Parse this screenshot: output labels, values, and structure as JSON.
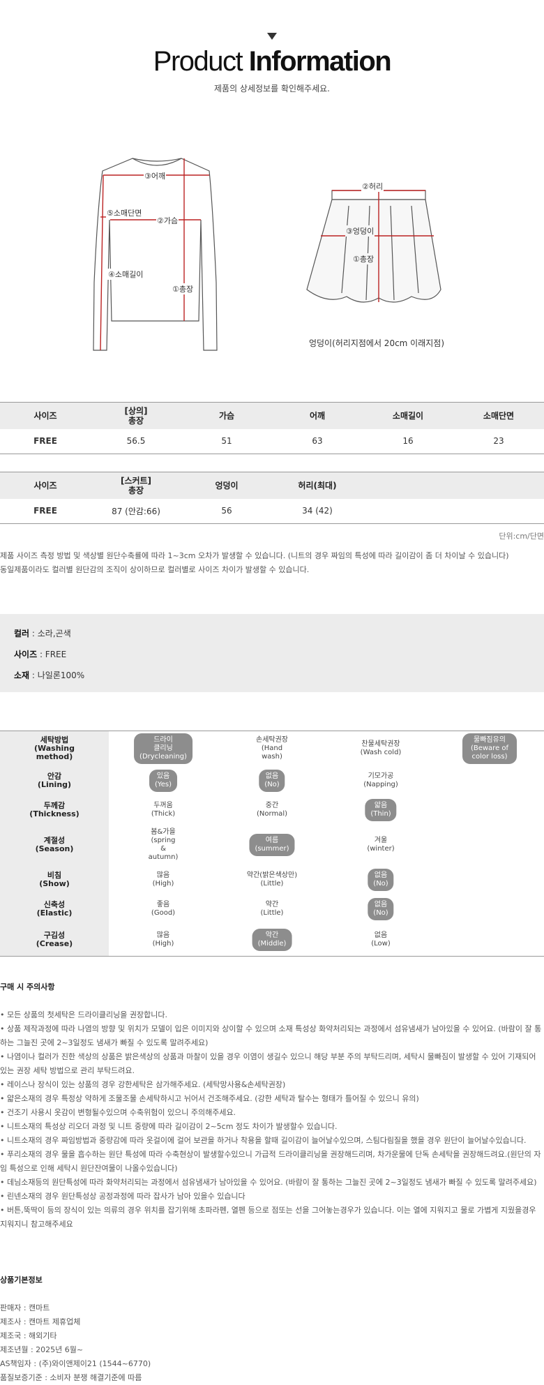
{
  "header": {
    "title_light": "Product",
    "title_bold": "Information",
    "subtitle": "제품의 상세정보를 확인해주세요."
  },
  "figures": {
    "top_labels": [
      "③어깨",
      "⑤소매단면",
      "②가슴",
      "④소매길이",
      "①총장"
    ],
    "skirt_labels": [
      "②허리",
      "③엉덩이",
      "①총장"
    ],
    "skirt_caption": "엉덩이(허리지점에서 20cm 이래지점)"
  },
  "table_top": {
    "headers": [
      "사이즈",
      "[상의]\n총장",
      "가슴",
      "어깨",
      "소매길이",
      "소매단면"
    ],
    "rows": [
      [
        "FREE",
        "56.5",
        "51",
        "63",
        "16",
        "23"
      ]
    ]
  },
  "table_skirt": {
    "headers": [
      "사이즈",
      "[스커트]\n총장",
      "엉덩이",
      "허리(최대)"
    ],
    "rows": [
      [
        "FREE",
        "87 (안감:66)",
        "56",
        "34 (42)"
      ]
    ]
  },
  "unit_text": "단위:cm/단면",
  "notes": [
    "제품 사이즈 측정 방법 및 색상별 원단수축률에 따라 1~3cm 오차가 발생할 수 있습니다. (니트의 경우 짜임의 특성에 따라 길이감이 좀 더 차이날 수 있습니다)",
    "동일제품이라도 컬러별 원단감의 조직이 상이하므로 컬러별로 사이즈 차이가 발생할 수 있습니다."
  ],
  "spec": {
    "color_label": "컬러",
    "color_value": " : 소라,곤색",
    "size_label": "사이즈",
    "size_value": " : FREE",
    "material_label": "소재",
    "material_value": " : 나일론100%"
  },
  "care": [
    {
      "label": "세탁방법\n(Washing\nmethod)",
      "options": [
        {
          "text": "드라이\n클리닝\n(Drycleaning)",
          "selected": true
        },
        {
          "text": "손세탁권장\n(Hand\nwash)",
          "selected": false
        },
        {
          "text": "찬물세탁권장\n(Wash cold)",
          "selected": false
        },
        {
          "text": "물빠짐유의\n(Beware of color loss)",
          "selected": true
        }
      ]
    },
    {
      "label": "안감\n(Lining)",
      "options": [
        {
          "text": "있음\n(Yes)",
          "selected": true
        },
        {
          "text": "없음\n(No)",
          "selected": true
        },
        {
          "text": "기모가공\n(Napping)",
          "selected": false
        }
      ]
    },
    {
      "label": "두께감\n(Thickness)",
      "options": [
        {
          "text": "두꺼움\n(Thick)",
          "selected": false
        },
        {
          "text": "중간\n(Normal)",
          "selected": false
        },
        {
          "text": "얇음\n(Thin)",
          "selected": true
        }
      ]
    },
    {
      "label": "계절성\n(Season)",
      "options": [
        {
          "text": "봄&가을\n(spring\n&\nautumn)",
          "selected": false
        },
        {
          "text": "여름\n(summer)",
          "selected": true
        },
        {
          "text": "겨울\n(winter)",
          "selected": false
        }
      ]
    },
    {
      "label": "비침\n(Show)",
      "options": [
        {
          "text": "많음\n(High)",
          "selected": false
        },
        {
          "text": "약간(밝은색상만)\n(Little)",
          "selected": false
        },
        {
          "text": "없음\n(No)",
          "selected": true
        }
      ]
    },
    {
      "label": "신축성\n(Elastic)",
      "options": [
        {
          "text": "좋음\n(Good)",
          "selected": false
        },
        {
          "text": "약간\n(Little)",
          "selected": false
        },
        {
          "text": "없음\n(No)",
          "selected": true
        }
      ]
    },
    {
      "label": "구김성\n(Crease)",
      "options": [
        {
          "text": "많음\n(High)",
          "selected": false
        },
        {
          "text": "약간\n(Middle)",
          "selected": true
        },
        {
          "text": "없음\n(Low)",
          "selected": false
        }
      ]
    }
  ],
  "caution": {
    "heading": "구매 시 주의사항",
    "items": [
      "• 모든 상품의 첫세탁은 드라이클리닝을 권장합니다.",
      "• 상품 제작과정에 따라 나염의 방향 및 위치가 모델이 입은 이미지와 상이할 수 있으며 소재 특성상 화약처리되는 과정에서 섬유냄새가 남아있을 수 있어요. (바람이 잘 통",
      "하는 그늘진 곳에 2~3일정도 냄새가 빠질 수 있도록 말려주세요)",
      "• 나염이나 컬러가 진한 색상의 상품은 밝은색상의 상품과 마찰이 있을 경우 이염이 생길수 있으니 해당 부분 주의 부탁드리며, 세탁시 물빠짐이 발생할 수 있어 기재되어",
      "있는 권장 세탁 방법으로 관리 부탁드려요.",
      "• 레이스나 장식이 있는 상품의 경우 강한세탁은 삼가해주세요. (세탁망사용&손세탁권장)",
      "• 얇은소재의 경우 특정상 약하게 조물조물 손세탁하시고 뉘어서 건조해주세요. (강한 세탁과 탈수는 형태가 틀어질 수 있으니 유의)",
      "• 건조기 사용시 옷감이 변형될수있으며 수축위험이 있으니 주의해주세요.",
      "• 니트소재의 특성상 리오더 과정 및 니트 중량에 따라 길이감이 2~5cm 정도 차이가 발생할수 있습니다.",
      "• 니트소재의 경우 짜임방법과 중량감에 따라 옷걸이에 걸어 보관을 하거나 착용을 할때 길이감이 늘어날수있으며, 스팀다림질을 했을 경우 원단이 늘어날수있습니다.",
      "• 푸리소재의 경우 물을 흡수하는 원단 특성에 따라 수축현상이 발생할수있으니 가급적 드라이클리닝을 권장해드리며, 차가운물에 단독 손세탁을 권장해드려요.(원단의 자",
      "임 특성으로 인해 세탁시 원단잔여물이 나올수있습니다)",
      "• 데님소재등의 원단특성에 따라 화약처리되는 과정에서 섬유냄새가 남아있을 수 있어요. (바람이 잘 통하는 그늘진 곳에 2~3일정도 냄새가 빠질 수 있도록 말려주세요)",
      "• 린넨소재의 경우 원단특성상 공정과정에 따라 잡사가 남아 있을수 있습니다",
      "• 버튼,뚝딱이 등의 장식이 있는 의류의 경우 위치를 잡기위해 초파라펜, 열펜 등으로 점또는 선을 그어놓는경우가 있습니다. 이는 열에 지워지고 물로 가볍게 지웠을경우",
      "지워지니 참고해주세요"
    ]
  },
  "basic_info": {
    "heading": "상품기본정보",
    "lines": [
      "판매자 : 캔마트",
      "제조사 : 캔마트 제휴업체",
      "제조국 : 해외기타",
      "제조년월 : 2025년 6월~",
      "AS책임자 : (주)와이앤제이21 (1544~6770)",
      "품질보증기준 : 소비자 분쟁 해결기준에 따름"
    ]
  }
}
